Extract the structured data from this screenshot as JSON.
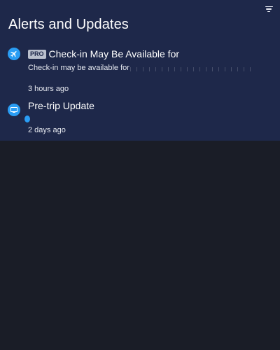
{
  "header": {
    "title": "Alerts and Updates",
    "filter_icon": "filter-icon"
  },
  "alerts": [
    {
      "icon": "airplane-icon",
      "badge": "PRO",
      "title": "Check-in May Be Available for",
      "body": "Check-in may be available for",
      "time": "3 hours ago"
    },
    {
      "icon": "screen-icon",
      "title": "Pre-trip Update",
      "time": "2 days ago"
    }
  ],
  "colors": {
    "panel": "#1e284a",
    "background": "#1a1d27",
    "accent": "#2a9df4"
  }
}
